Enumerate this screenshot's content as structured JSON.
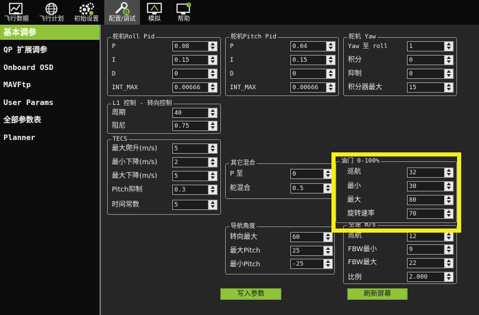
{
  "toolbar": {
    "items": [
      {
        "label": "飞行数据",
        "icon": "flight-data-icon"
      },
      {
        "label": "飞行计划",
        "icon": "globe-icon"
      },
      {
        "label": "初始设置",
        "icon": "setup-gears-icon"
      },
      {
        "label": "配置/调试",
        "icon": "config-tune-icon",
        "active": true
      },
      {
        "label": "模拟",
        "icon": "simulation-monitor-icon"
      },
      {
        "label": "帮助",
        "icon": "help-monitor-icon"
      }
    ]
  },
  "sidebar": {
    "items": [
      {
        "label": "基本调参",
        "active": true
      },
      {
        "label": "QP 扩展调参"
      },
      {
        "label": "Onboard OSD"
      },
      {
        "label": "MAVFtp"
      },
      {
        "label": "User Params"
      },
      {
        "label": "全部参数表"
      },
      {
        "label": "Planner"
      }
    ]
  },
  "roll_pid": {
    "title": "舵机Roll Pid",
    "p_label": "P",
    "p_value": "0.08",
    "i_label": "I",
    "i_value": "0.15",
    "d_label": "D",
    "d_value": "0",
    "imax_label": "INT_MAX",
    "imax_value": "0.00666"
  },
  "pitch_pid": {
    "title": "舵机Pitch Pid",
    "p_label": "P",
    "p_value": "0.04",
    "i_label": "I",
    "i_value": "0.15",
    "d_label": "D",
    "d_value": "0",
    "imax_label": "INT_MAX",
    "imax_value": "0.00666"
  },
  "yaw": {
    "title": "舵机 Yaw",
    "roll_label": "Yaw 至 roll",
    "roll_value": "1",
    "integral_label": "积分",
    "integral_value": "0",
    "damping_label": "抑制",
    "damping_value": "0",
    "imax_label": "积分器最大",
    "imax_value": "15"
  },
  "l1": {
    "title": "L1 控制 - 转向控制",
    "period_label": "周期",
    "period_value": "40",
    "damping_label": "阻尼",
    "damping_value": "0.75"
  },
  "tecs": {
    "title": "TECS",
    "climb_label": "最大爬升(m/s)",
    "climb_value": "5",
    "min_sink_label": "最小下降(m/s)",
    "min_sink_value": "2",
    "max_sink_label": "最大下降(m/s)",
    "max_sink_value": "5",
    "pitch_damp_label": "Pitch抑制",
    "pitch_damp_value": "0.3",
    "time_const_label": "时间常数",
    "time_const_value": "5"
  },
  "other_mix": {
    "title": "其它混合",
    "p_label": "P 至",
    "p_value": "0",
    "mix_label": "舵混合",
    "mix_value": "0.5"
  },
  "throttle": {
    "title": "油门 0-100%",
    "cruise_label": "巡航",
    "cruise_value": "32",
    "min_label": "最小",
    "min_value": "30",
    "max_label": "最大",
    "max_value": "80",
    "slew_label": "旋转速率",
    "slew_value": "70"
  },
  "nav_angle": {
    "title": "导航角度",
    "bank_label": "转向最大",
    "bank_value": "60",
    "pitch_max_label": "最大Pitch",
    "pitch_max_value": "25",
    "pitch_min_label": "最小Pitch",
    "pitch_min_value": "-25"
  },
  "airspeed": {
    "title": "空速 m/s",
    "cruise_label": "巡航",
    "cruise_value": "12",
    "fbw_min_label": "FBW最小",
    "fbw_min_value": "9",
    "fbw_max_label": "FBW最大",
    "fbw_max_value": "22",
    "ratio_label": "比例",
    "ratio_value": "2.000"
  },
  "actions": {
    "write_label": "写入参数",
    "refresh_label": "刷新屏幕"
  },
  "colors": {
    "accent": "#8fc43a",
    "highlight": "#f4ee1a",
    "background": "#262626"
  }
}
